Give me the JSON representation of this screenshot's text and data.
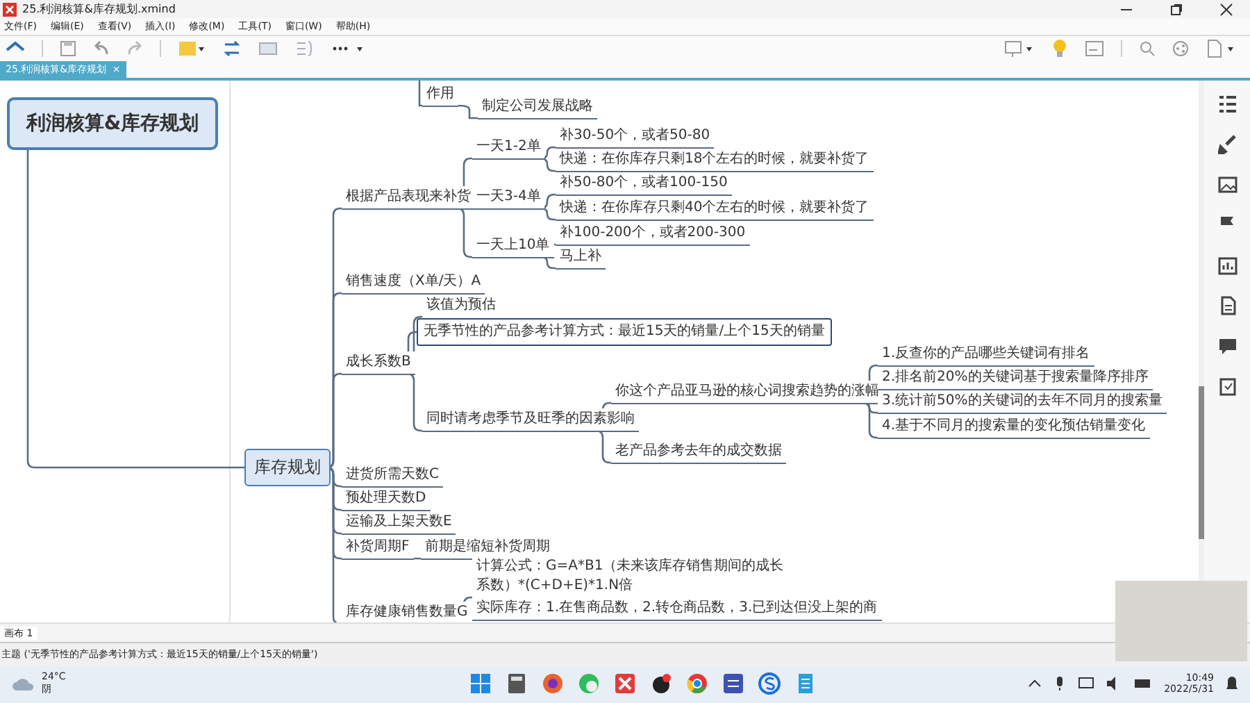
{
  "window": {
    "title": "25.利润核算&库存规划.xmind"
  },
  "menu": [
    "文件(F)",
    "编辑(E)",
    "查看(V)",
    "插入(I)",
    "修改(M)",
    "工具(T)",
    "窗口(W)",
    "帮助(H)"
  ],
  "document_tab": {
    "label": "25.利润核算&库存规划",
    "close": "×"
  },
  "mind_map": {
    "upper_branch": {
      "text": "作用",
      "children": [
        {
          "text": "制定公司发展战略",
          "selected": false
        }
      ]
    },
    "root": {
      "text": "利润核算&库存规划",
      "children": [
        {
          "text": "库存规划",
          "children": [
            {
              "text": "根据产品表现来补货",
              "selected": false,
              "children": [
                {
                  "text": "一天1-2单",
                  "selected": false,
                  "children": [
                    {
                      "text": "补30-50个，或者50-80",
                      "selected": false
                    },
                    {
                      "text": "快递：在你库存只剩18个左右的时候，就要补货了",
                      "selected": false
                    }
                  ]
                },
                {
                  "text": "一天3-4单",
                  "selected": false,
                  "children": [
                    {
                      "text": "补50-80个，或者100-150",
                      "selected": false
                    },
                    {
                      "text": "快递：在你库存只剩40个左右的时候，就要补货了",
                      "selected": false
                    }
                  ]
                },
                {
                  "text": "一天上10单",
                  "selected": false,
                  "children": [
                    {
                      "text": "补100-200个，或者200-300",
                      "selected": false
                    },
                    {
                      "text": "马上补",
                      "selected": false
                    }
                  ]
                }
              ]
            },
            {
              "text": "销售速度（X单/天）A",
              "selected": false
            },
            {
              "text": "成长系数B",
              "selected": false,
              "children": [
                {
                  "text": "该值为预估",
                  "selected": false,
                  "kind": "label"
                },
                {
                  "text": "无季节性的产品参考计算方式：最近15天的销量/上个15天的销量",
                  "selected": true
                },
                {
                  "text": "同时请考虑季节及旺季的因素影响",
                  "selected": false,
                  "children": [
                    {
                      "text": "你这个产品亚马逊的核心词搜索趋势的涨幅",
                      "selected": false,
                      "children": [
                        {
                          "text": "1.反查你的产品哪些关键词有排名",
                          "selected": false
                        },
                        {
                          "text": "2.排名前20%的关键词基于搜索量降序排序",
                          "selected": false
                        },
                        {
                          "text": "3.统计前50%的关键词的去年不同月的搜索量",
                          "selected": false
                        },
                        {
                          "text": "4.基于不同月的搜索量的变化预估销量变化",
                          "selected": false
                        }
                      ]
                    },
                    {
                      "text": "老产品参考去年的成交数据",
                      "selected": false
                    }
                  ]
                }
              ]
            },
            {
              "text": "进货所需天数C",
              "selected": false
            },
            {
              "text": "预处理天数D",
              "selected": false
            },
            {
              "text": "运输及上架天数E",
              "selected": false
            },
            {
              "text": "补货周期F",
              "selected": false,
              "children": [
                {
                  "text": "前期是缩短补货周期",
                  "selected": false
                }
              ]
            },
            {
              "text": "库存健康销售数量G",
              "selected": false,
              "children": [
                {
                  "text": "计算公式：G=A*B1（未来该库存销售期间的成长系数）*(C+D+E)*1.N倍",
                  "selected": false
                },
                {
                  "text": "实际库存：1.在售商品数，2.转仓商品数，3.已到达但没上架的商",
                  "selected": false
                }
              ]
            }
          ]
        }
      ]
    }
  },
  "sheet_tab": "画布 1",
  "status_bar": "主题 ('无季节性的产品参考计算方式：最近15天的销量/上个15天的销量')",
  "taskbar": {
    "weather_temp": "24°C",
    "weather_text": "阴",
    "time": "10:49",
    "date": "2022/5/31"
  }
}
